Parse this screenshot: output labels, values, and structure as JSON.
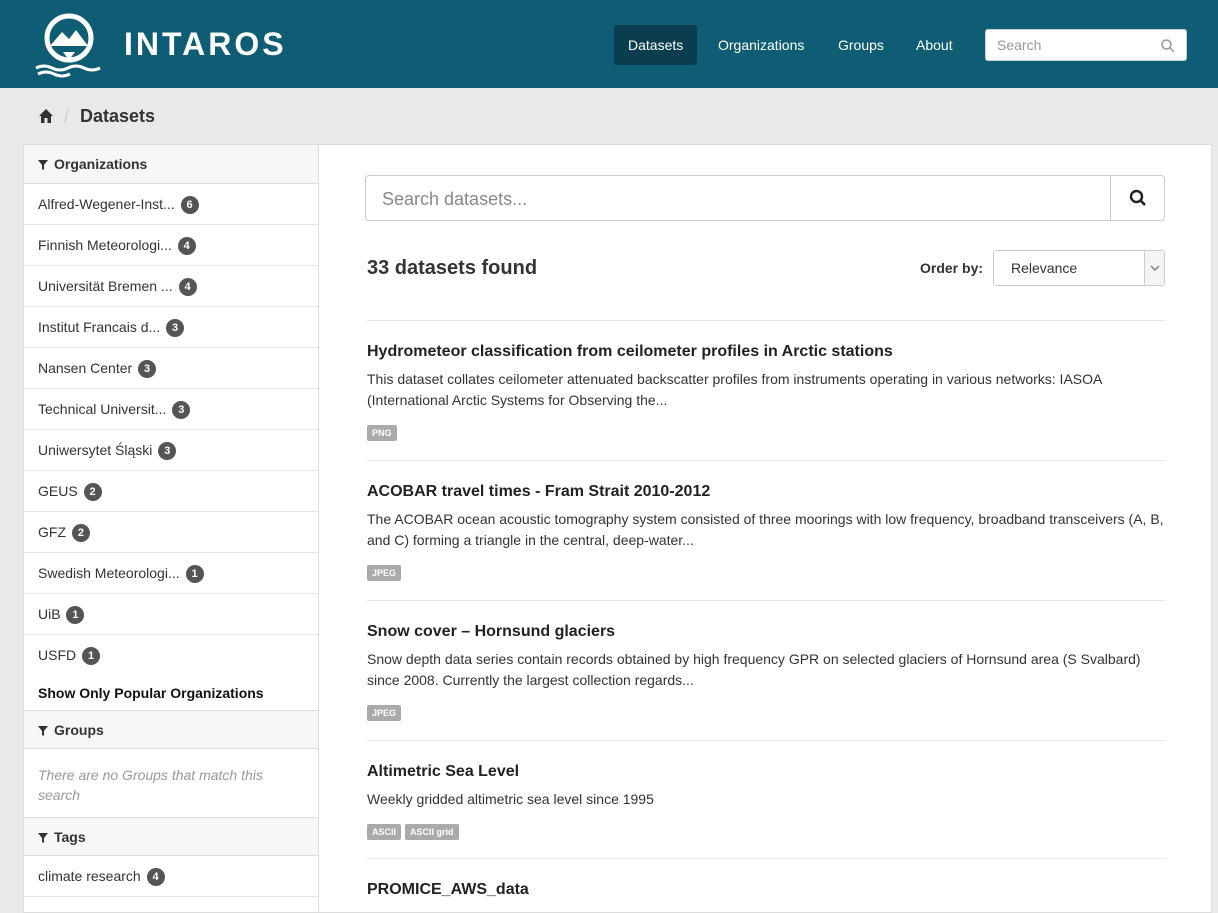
{
  "header": {
    "brand": "INTAROS",
    "nav": [
      {
        "label": "Datasets",
        "active": true
      },
      {
        "label": "Organizations",
        "active": false
      },
      {
        "label": "Groups",
        "active": false
      },
      {
        "label": "About",
        "active": false
      }
    ],
    "search_placeholder": "Search",
    "colors": {
      "bar": "#0e5d74",
      "active_nav": "#0a3e4e"
    }
  },
  "breadcrumb": {
    "home_icon": "home-icon",
    "current": "Datasets"
  },
  "sidebar": {
    "organizations": {
      "title": "Organizations",
      "items": [
        {
          "label": "Alfred-Wegener-Inst...",
          "count": "6"
        },
        {
          "label": "Finnish Meteorologi...",
          "count": "4"
        },
        {
          "label": "Universität Bremen ...",
          "count": "4"
        },
        {
          "label": "Institut Francais d...",
          "count": "3"
        },
        {
          "label": "Nansen Center",
          "count": "3"
        },
        {
          "label": "Technical Universit...",
          "count": "3"
        },
        {
          "label": "Uniwersytet Śląski",
          "count": "3"
        },
        {
          "label": "GEUS",
          "count": "2"
        },
        {
          "label": "GFZ",
          "count": "2"
        },
        {
          "label": "Swedish Meteorologi...",
          "count": "1"
        },
        {
          "label": "UiB",
          "count": "1"
        },
        {
          "label": "USFD",
          "count": "1"
        }
      ],
      "show_popular": "Show Only Popular Organizations"
    },
    "groups": {
      "title": "Groups",
      "empty": "There are no Groups that match this search"
    },
    "tags": {
      "title": "Tags",
      "items": [
        {
          "label": "climate research",
          "count": "4"
        }
      ]
    }
  },
  "main": {
    "search_placeholder": "Search datasets...",
    "found": "33 datasets found",
    "order_label": "Order by:",
    "order_value": "Relevance",
    "datasets": [
      {
        "title": "Hydrometeor classification from ceilometer profiles in Arctic stations",
        "description": "This dataset collates ceilometer attenuated backscatter profiles from instruments operating in various networks: IASOA (International Arctic Systems for Observing the...",
        "formats": [
          "PNG"
        ]
      },
      {
        "title": "ACOBAR travel times - Fram Strait 2010-2012",
        "description": "The ACOBAR ocean acoustic tomography system consisted of three moorings with low frequency, broadband transceivers (A, B, and C) forming a triangle in the central, deep-water...",
        "formats": [
          "JPEG"
        ]
      },
      {
        "title": "Snow cover – Hornsund glaciers",
        "description": "Snow depth data series contain records obtained by high frequency GPR on selected glaciers of Hornsund area (S Svalbard) since 2008. Currently the largest collection regards...",
        "formats": [
          "JPEG"
        ]
      },
      {
        "title": "Altimetric Sea Level",
        "description": "Weekly gridded altimetric sea level since 1995",
        "formats": [
          "ASCII",
          "ASCII grid"
        ]
      },
      {
        "title": "PROMICE_AWS_data",
        "description": "",
        "formats": []
      }
    ]
  }
}
